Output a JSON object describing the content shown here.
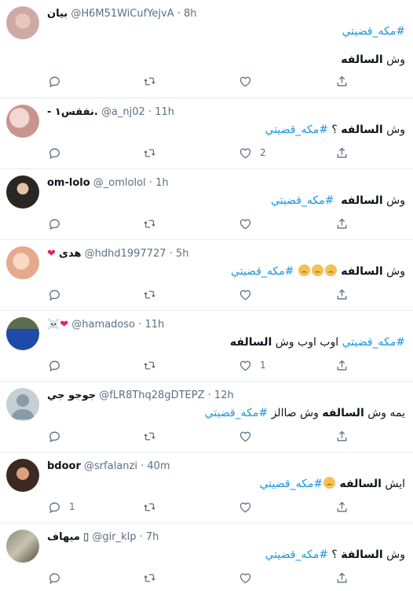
{
  "colors": {
    "link": "#1b95e0",
    "secondary": "#5b7083",
    "divider": "#e6ecf0",
    "heart": "#e0245e"
  },
  "tweets": [
    {
      "name": "بيان",
      "handle": "@H6M51WiCufYejvA",
      "dot": "·",
      "time": "8h",
      "line1_tag": "#مكه_قضيتي",
      "line2_pre": "وش ",
      "line2_bold": "السالفه",
      "reply_count": "",
      "like_count": ""
    },
    {
      "name": "- نفقس١.",
      "handle": "@a_nj02",
      "dot": "·",
      "time": "11h",
      "pre": "وش ",
      "bold": "السالفه",
      "post": " ؟ ",
      "tag": "#مكه_قضيتي",
      "like_count": "2"
    },
    {
      "name": "om-lolo",
      "handle": "@_omlolol",
      "dot": "·",
      "time": "1h",
      "pre": "وش ",
      "bold": "السالفه",
      "tag": "#مكه_قضيتي"
    },
    {
      "name": "هدى",
      "handle": "@hdhd1997727",
      "dot": "·",
      "time": "5h",
      "pre": "وش ",
      "bold": "السالفه",
      "emoji": [
        "confused-face",
        "confused-face",
        "confused-face"
      ],
      "tag": "#مكه_قضيتي"
    },
    {
      "name": "☠️",
      "handle": "@hamadoso",
      "dot": "·",
      "time": "11h",
      "tag": "#مكه_قضيتي",
      "mid": " اوب اوب وش ",
      "bold": "السالفه",
      "like_count": "1"
    },
    {
      "name": "جوجو جي",
      "handle": "@fLR8Thq28gDTEPZ",
      "dot": "·",
      "time": "12h",
      "pre": "يمه وش ",
      "bold": "السالفه",
      "mid": " وش صاالز ",
      "tag": "#مكه_قضيتي"
    },
    {
      "name": "bdoor",
      "handle": "@srfalanzi",
      "dot": "·",
      "time": "40m",
      "pre": "ايش ",
      "bold": "السالفه",
      "emoji": "anxious-face",
      "tag": "#مكه_قضيتي",
      "reply_count": "1"
    },
    {
      "name": "ميهاف",
      "handle": "@gir_klp",
      "dot": "·",
      "time": "7h",
      "pre": "وش ",
      "bold": "السالفة",
      "post": " ؟ ",
      "tag": "#مكه_قضيتي"
    }
  ]
}
